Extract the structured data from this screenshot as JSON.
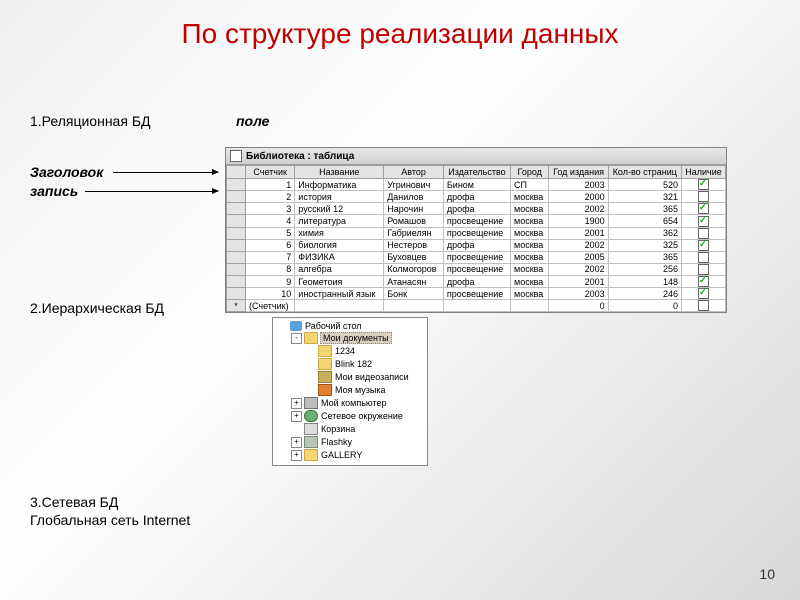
{
  "title": "По структуре реализации данных",
  "page": "10",
  "labels": {
    "relational": "1.Реляционная БД",
    "field": "поле",
    "header": "Заголовок",
    "record": "запись",
    "hierarchical": "2.Иерархическая БД",
    "network": "3.Сетевая БД",
    "internet": "Глобальная сеть Internet"
  },
  "dbwindow": {
    "title": "Библиотека : таблица",
    "columns": [
      "",
      "Счетчик",
      "Название",
      "Автор",
      "Издательство",
      "Город",
      "Год издания",
      "Кол-во страниц",
      "Наличие"
    ],
    "rows": [
      {
        "n": "1",
        "name": "Информатика",
        "author": "Угринович",
        "pub": "Бином",
        "city": "СП",
        "year": "2003",
        "pages": "520",
        "avail": true
      },
      {
        "n": "2",
        "name": "история",
        "author": "Данилов",
        "pub": "дрофа",
        "city": "москва",
        "year": "2000",
        "pages": "321",
        "avail": false
      },
      {
        "n": "3",
        "name": "русский 12",
        "author": "Нарочин",
        "pub": "дрофа",
        "city": "москва",
        "year": "2002",
        "pages": "365",
        "avail": true
      },
      {
        "n": "4",
        "name": "литература",
        "author": "Ромашов",
        "pub": "просвещение",
        "city": "москва",
        "year": "1900",
        "pages": "654",
        "avail": true
      },
      {
        "n": "5",
        "name": "химия",
        "author": "Габриелян",
        "pub": "просвещение",
        "city": "москва",
        "year": "2001",
        "pages": "362",
        "avail": false
      },
      {
        "n": "6",
        "name": "биология",
        "author": "Нестеров",
        "pub": "дрофа",
        "city": "москва",
        "year": "2002",
        "pages": "325",
        "avail": true
      },
      {
        "n": "7",
        "name": "ФИЗИКА",
        "author": "Буховцев",
        "pub": "просвещение",
        "city": "москва",
        "year": "2005",
        "pages": "365",
        "avail": false
      },
      {
        "n": "8",
        "name": "алгебра",
        "author": "Колмогоров",
        "pub": "просвещение",
        "city": "москва",
        "year": "2002",
        "pages": "256",
        "avail": false
      },
      {
        "n": "9",
        "name": "Геометоия",
        "author": "Атанасян",
        "pub": "дрофа",
        "city": "москва",
        "year": "2001",
        "pages": "148",
        "avail": true
      },
      {
        "n": "10",
        "name": "иностранный язык",
        "author": "Бонк",
        "pub": "просвещение",
        "city": "москва",
        "year": "2003",
        "pages": "246",
        "avail": true
      }
    ],
    "footer": {
      "label": "(Счетчик)",
      "zero": "0"
    }
  },
  "tree": [
    {
      "indent": 0,
      "pm": "",
      "icon": "desktop",
      "label": "Рабочий стол",
      "sel": false
    },
    {
      "indent": 1,
      "pm": "-",
      "icon": "folderopen",
      "label": "Мои документы",
      "sel": true
    },
    {
      "indent": 2,
      "pm": "",
      "icon": "folder",
      "label": "1234",
      "sel": false
    },
    {
      "indent": 2,
      "pm": "",
      "icon": "folder",
      "label": "Blink 182",
      "sel": false
    },
    {
      "indent": 2,
      "pm": "",
      "icon": "video",
      "label": "Мои видеозаписи",
      "sel": false
    },
    {
      "indent": 2,
      "pm": "",
      "icon": "music",
      "label": "Моя музыка",
      "sel": false
    },
    {
      "indent": 1,
      "pm": "+",
      "icon": "computer",
      "label": "Мой компьютер",
      "sel": false
    },
    {
      "indent": 1,
      "pm": "+",
      "icon": "network",
      "label": "Сетевое окружение",
      "sel": false
    },
    {
      "indent": 1,
      "pm": "",
      "icon": "trash",
      "label": "Корзина",
      "sel": false
    },
    {
      "indent": 1,
      "pm": "+",
      "icon": "flash",
      "label": "Flashky",
      "sel": false
    },
    {
      "indent": 1,
      "pm": "+",
      "icon": "folder",
      "label": "GALLERY",
      "sel": false
    }
  ]
}
